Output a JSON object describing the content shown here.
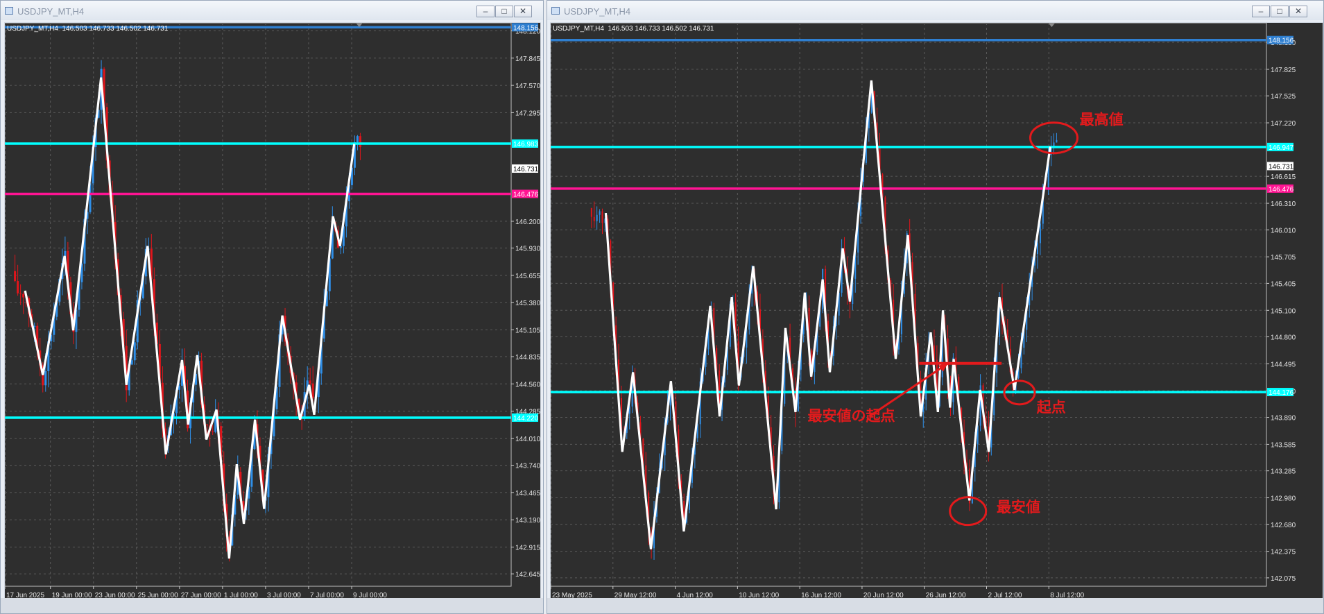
{
  "windows": [
    {
      "title": "USDJPY_MT,H4",
      "header": "USDJPY_MT,H4  146.503 146.733 146.502 146.731",
      "chart_data": {
        "type": "candlestick",
        "symbol": "USDJPY_MT",
        "timeframe": "H4",
        "ylim": [
          142.52,
          148.2
        ],
        "y_ticks": [
          "142.645",
          "142.915",
          "143.190",
          "143.465",
          "143.740",
          "144.010",
          "144.285",
          "144.560",
          "144.835",
          "145.105",
          "145.380",
          "145.655",
          "145.930",
          "146.200",
          "147.295",
          "147.570",
          "147.845",
          "148.120"
        ],
        "x_ticks": [
          "17 Jun 2025",
          "19 Jun 00:00",
          "23 Jun 00:00",
          "25 Jun 00:00",
          "27 Jun 00:00",
          "1 Jul 00:00",
          "3 Jul 00:00",
          "7 Jul 00:00",
          "9 Jul 00:00"
        ],
        "x_tick_fracs": [
          0.0,
          0.09,
          0.175,
          0.26,
          0.345,
          0.43,
          0.515,
          0.6,
          0.685
        ],
        "price_tags": [
          {
            "value": 148.156,
            "label": "148.156",
            "color": "#2f7fd0",
            "line": true
          },
          {
            "value": 146.983,
            "label": "146.983",
            "color": "#00ffff",
            "line": true
          },
          {
            "value": 146.731,
            "label": "146.731",
            "color": "#ffffff",
            "line": false
          },
          {
            "value": 146.476,
            "label": "146.476",
            "color": "#ff1493",
            "line": true
          },
          {
            "value": 144.22,
            "label": "144.220",
            "color": "#00ffff",
            "line": true
          }
        ],
        "zigzag": [
          [
            0.04,
            145.5
          ],
          [
            0.075,
            144.65
          ],
          [
            0.118,
            145.85
          ],
          [
            0.135,
            145.1
          ],
          [
            0.19,
            147.65
          ],
          [
            0.24,
            144.55
          ],
          [
            0.282,
            145.95
          ],
          [
            0.318,
            143.85
          ],
          [
            0.35,
            144.8
          ],
          [
            0.362,
            144.15
          ],
          [
            0.38,
            144.85
          ],
          [
            0.398,
            144.0
          ],
          [
            0.418,
            144.3
          ],
          [
            0.443,
            142.8
          ],
          [
            0.458,
            143.75
          ],
          [
            0.472,
            143.15
          ],
          [
            0.494,
            144.2
          ],
          [
            0.512,
            143.3
          ],
          [
            0.548,
            145.25
          ],
          [
            0.583,
            144.2
          ],
          [
            0.601,
            144.55
          ],
          [
            0.611,
            144.25
          ],
          [
            0.648,
            146.25
          ],
          [
            0.662,
            145.95
          ],
          [
            0.69,
            146.98
          ]
        ]
      },
      "annotations": []
    },
    {
      "title": "USDJPY_MT,H4",
      "header": "USDJPY_MT,H4  146.503 146.733 146.502 146.731",
      "chart_data": {
        "type": "candlestick",
        "symbol": "USDJPY_MT",
        "timeframe": "H4",
        "ylim": [
          141.98,
          148.35
        ],
        "y_ticks": [
          "142.075",
          "142.375",
          "142.680",
          "142.980",
          "143.285",
          "143.585",
          "143.890",
          "144.190",
          "144.495",
          "144.800",
          "145.100",
          "145.405",
          "145.705",
          "146.010",
          "146.310",
          "146.615",
          "147.220",
          "147.525",
          "147.825",
          "148.130"
        ],
        "x_ticks": [
          "23 May 2025",
          "29 May 12:00",
          "4 Jun 12:00",
          "10 Jun 12:00",
          "16 Jun 12:00",
          "20 Jun 12:00",
          "26 Jun 12:00",
          "2 Jul 12:00",
          "8 Jul 12:00"
        ],
        "x_tick_fracs": [
          0.0,
          0.087,
          0.174,
          0.261,
          0.348,
          0.435,
          0.522,
          0.609,
          0.696
        ],
        "price_tags": [
          {
            "value": 148.156,
            "label": "148.156",
            "color": "#2f7fd0",
            "line": true
          },
          {
            "value": 146.947,
            "label": "146.947",
            "color": "#00ffff",
            "line": true
          },
          {
            "value": 146.731,
            "label": "146.731",
            "color": "#ffffff",
            "line": false
          },
          {
            "value": 146.476,
            "label": "146.476",
            "color": "#ff1493",
            "line": true
          },
          {
            "value": 144.176,
            "label": "144.176",
            "color": "#00ffff",
            "line": true
          }
        ],
        "zigzag": [
          [
            0.077,
            146.2
          ],
          [
            0.1,
            143.5
          ],
          [
            0.115,
            144.4
          ],
          [
            0.14,
            142.4
          ],
          [
            0.168,
            144.3
          ],
          [
            0.186,
            142.6
          ],
          [
            0.223,
            145.15
          ],
          [
            0.236,
            143.9
          ],
          [
            0.253,
            145.25
          ],
          [
            0.263,
            144.25
          ],
          [
            0.283,
            145.6
          ],
          [
            0.315,
            142.85
          ],
          [
            0.328,
            144.9
          ],
          [
            0.342,
            143.95
          ],
          [
            0.355,
            145.3
          ],
          [
            0.364,
            144.35
          ],
          [
            0.38,
            145.45
          ],
          [
            0.39,
            144.4
          ],
          [
            0.408,
            145.8
          ],
          [
            0.418,
            145.2
          ],
          [
            0.448,
            147.7
          ],
          [
            0.482,
            144.55
          ],
          [
            0.499,
            145.95
          ],
          [
            0.517,
            143.9
          ],
          [
            0.531,
            144.85
          ],
          [
            0.541,
            143.95
          ],
          [
            0.548,
            145.1
          ],
          [
            0.558,
            144.0
          ],
          [
            0.563,
            144.55
          ],
          [
            0.585,
            142.95
          ],
          [
            0.6,
            144.2
          ],
          [
            0.612,
            143.5
          ],
          [
            0.627,
            145.25
          ],
          [
            0.648,
            144.2
          ],
          [
            0.698,
            146.95
          ]
        ],
        "markers": {
          "hline_y": 144.5,
          "hline_x0": 0.515,
          "hline_x1": 0.63,
          "arrow_from": [
            0.445,
            143.9
          ],
          "arrow_to": [
            0.555,
            144.5
          ],
          "ellipse_high": [
            0.703,
            147.05
          ],
          "ellipse_start": [
            0.655,
            144.17
          ],
          "ellipse_low": [
            0.583,
            142.83
          ]
        }
      },
      "annotations": [
        {
          "text": "最高値",
          "value_x": 0.739,
          "value_y": 147.2
        },
        {
          "text": "起点",
          "value_x": 0.679,
          "value_y": 143.95
        },
        {
          "text": "最安値の起点",
          "value_x": 0.359,
          "value_y": 143.85
        },
        {
          "text": "最安値",
          "value_x": 0.623,
          "value_y": 142.82
        }
      ]
    }
  ]
}
